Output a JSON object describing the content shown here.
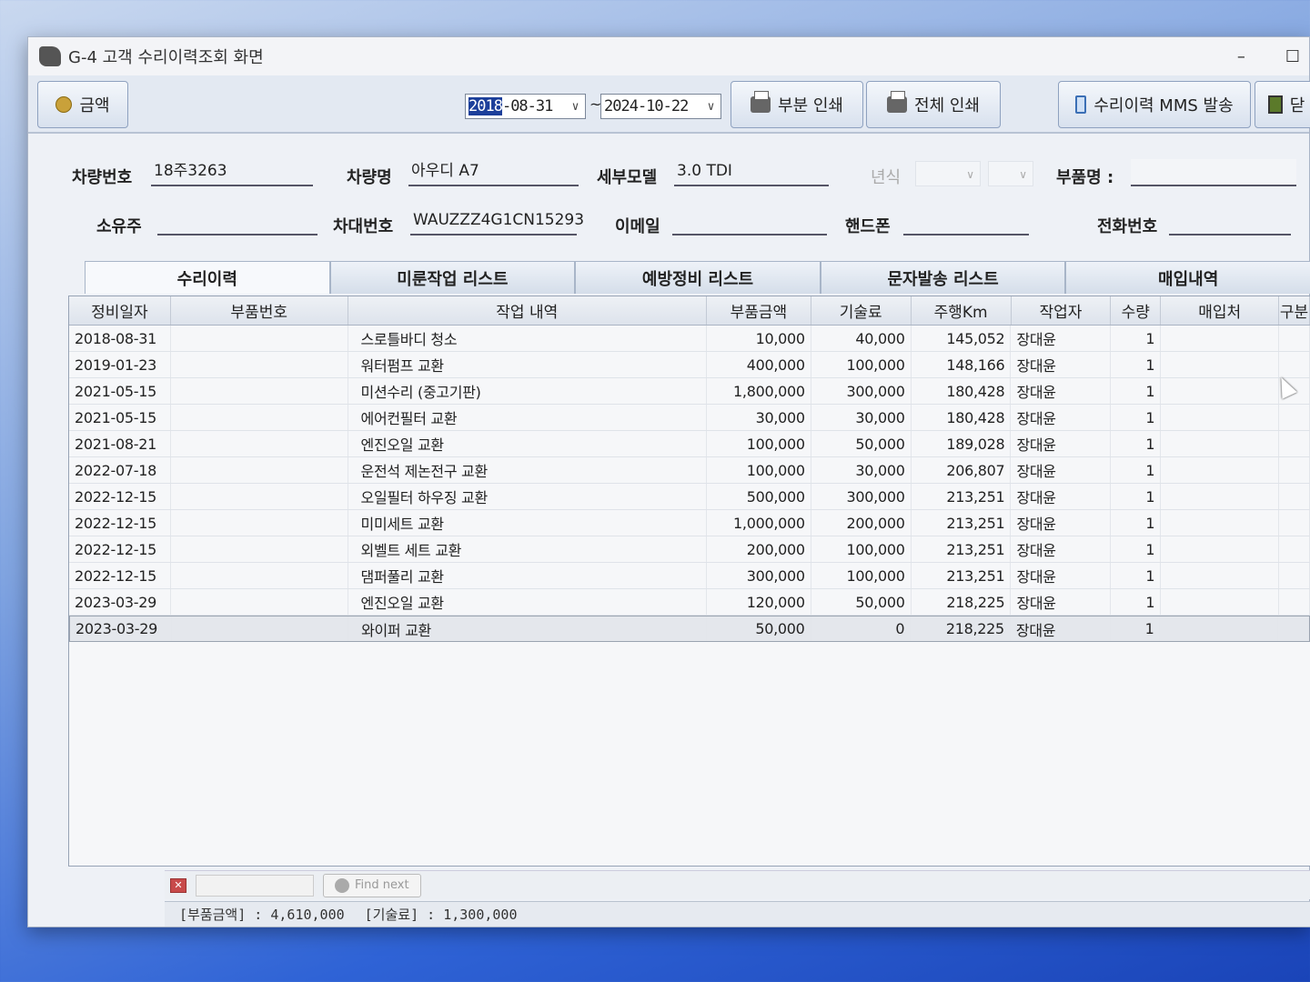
{
  "window": {
    "title": "G-4 고객 수리이력조회 화면",
    "minimize": "–",
    "maximize": "☐"
  },
  "toolbar": {
    "amount_button": "금액",
    "date_from": {
      "selected": "2018",
      "rest": "-08-31"
    },
    "date_sep": "~",
    "date_to": "2024-10-22",
    "partial_print": "부분 인쇄",
    "full_print": "전체 인쇄",
    "mms_send": "수리이력 MMS 발송",
    "close": "닫"
  },
  "fields": {
    "plate_label": "차량번호",
    "plate_value": "18주3263",
    "car_name_label": "차량명",
    "car_name_value": "아우디 A7",
    "model_label": "세부모델",
    "model_value": "3.0 TDI",
    "year_label": "년식",
    "part_name_label": "부품명 :",
    "part_name_value": "",
    "owner_label": "소유주",
    "owner_value": "",
    "vin_label": "차대번호",
    "vin_value": "WAUZZZ4G1CN15293",
    "email_label": "이메일",
    "email_value": "",
    "mobile_label": "핸드폰",
    "mobile_value": "",
    "phone_label": "전화번호",
    "phone_value": ""
  },
  "tabs": [
    "수리이력",
    "미룬작업 리스트",
    "예방정비 리스트",
    "문자발송 리스트",
    "매입내역"
  ],
  "grid": {
    "columns": [
      "정비일자",
      "부품번호",
      "작업 내역",
      "부품금액",
      "기술료",
      "주행Km",
      "작업자",
      "수량",
      "매입처",
      "구분"
    ],
    "rows": [
      [
        "2018-08-31",
        "",
        "스로틀바디 청소",
        "10,000",
        "40,000",
        "145,052",
        "장대윤",
        "1",
        "",
        ""
      ],
      [
        "2019-01-23",
        "",
        "워터펌프 교환",
        "400,000",
        "100,000",
        "148,166",
        "장대윤",
        "1",
        "",
        ""
      ],
      [
        "2021-05-15",
        "",
        "미션수리 (중고기판)",
        "1,800,000",
        "300,000",
        "180,428",
        "장대윤",
        "1",
        "",
        ""
      ],
      [
        "2021-05-15",
        "",
        "에어컨필터 교환",
        "30,000",
        "30,000",
        "180,428",
        "장대윤",
        "1",
        "",
        ""
      ],
      [
        "2021-08-21",
        "",
        "엔진오일 교환",
        "100,000",
        "50,000",
        "189,028",
        "장대윤",
        "1",
        "",
        ""
      ],
      [
        "2022-07-18",
        "",
        "운전석 제논전구 교환",
        "100,000",
        "30,000",
        "206,807",
        "장대윤",
        "1",
        "",
        ""
      ],
      [
        "2022-12-15",
        "",
        "오일필터 하우징 교환",
        "500,000",
        "300,000",
        "213,251",
        "장대윤",
        "1",
        "",
        ""
      ],
      [
        "2022-12-15",
        "",
        "미미세트 교환",
        "1,000,000",
        "200,000",
        "213,251",
        "장대윤",
        "1",
        "",
        ""
      ],
      [
        "2022-12-15",
        "",
        "외벨트 세트 교환",
        "200,000",
        "100,000",
        "213,251",
        "장대윤",
        "1",
        "",
        ""
      ],
      [
        "2022-12-15",
        "",
        "댐퍼풀리 교환",
        "300,000",
        "100,000",
        "213,251",
        "장대윤",
        "1",
        "",
        ""
      ],
      [
        "2023-03-29",
        "",
        "엔진오일 교환",
        "120,000",
        "50,000",
        "218,225",
        "장대윤",
        "1",
        "",
        ""
      ],
      [
        "2023-03-29",
        "",
        "와이퍼 교환",
        "50,000",
        "0",
        "218,225",
        "장대윤",
        "1",
        "",
        ""
      ]
    ],
    "selected_row": 11
  },
  "findbar": {
    "find_next": "Find next",
    "query": ""
  },
  "status": {
    "parts_total": "[부품금액] : 4,610,000",
    "labor_total": "[기술료] : 1,300,000"
  }
}
